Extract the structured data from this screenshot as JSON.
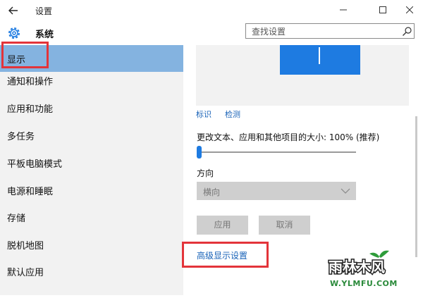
{
  "window": {
    "title": "设置",
    "back_icon": "arrow-left-icon",
    "controls": [
      "minimize-icon",
      "maximize-icon",
      "close-icon"
    ]
  },
  "header": {
    "section_title": "系统",
    "section_icon": "gear-icon"
  },
  "search": {
    "placeholder": "查找设置",
    "icon": "search-icon"
  },
  "sidebar": {
    "items": [
      {
        "label": "显示",
        "active": true
      },
      {
        "label": "通知和操作"
      },
      {
        "label": "应用和功能"
      },
      {
        "label": "多任务"
      },
      {
        "label": "平板电脑模式"
      },
      {
        "label": "电源和睡眠"
      },
      {
        "label": "存储"
      },
      {
        "label": "脱机地图"
      },
      {
        "label": "默认应用"
      }
    ]
  },
  "display": {
    "identify_link": "标识",
    "detect_link": "检测",
    "scale_label": "更改文本、应用和其他项目的大小: 100% (推荐)",
    "scale_value_percent": 100,
    "orientation_label": "方向",
    "orientation_value": "横向",
    "apply_label": "应用",
    "cancel_label": "取消",
    "advanced_link": "高级显示设置"
  },
  "colors": {
    "accent": "#1e7be1",
    "sidebar_active": "#84b3e0",
    "highlight": "#e3343a",
    "link": "#1a63b8"
  },
  "watermark": {
    "brand": "雨林木风",
    "url": "W.YLMFU.COM"
  }
}
